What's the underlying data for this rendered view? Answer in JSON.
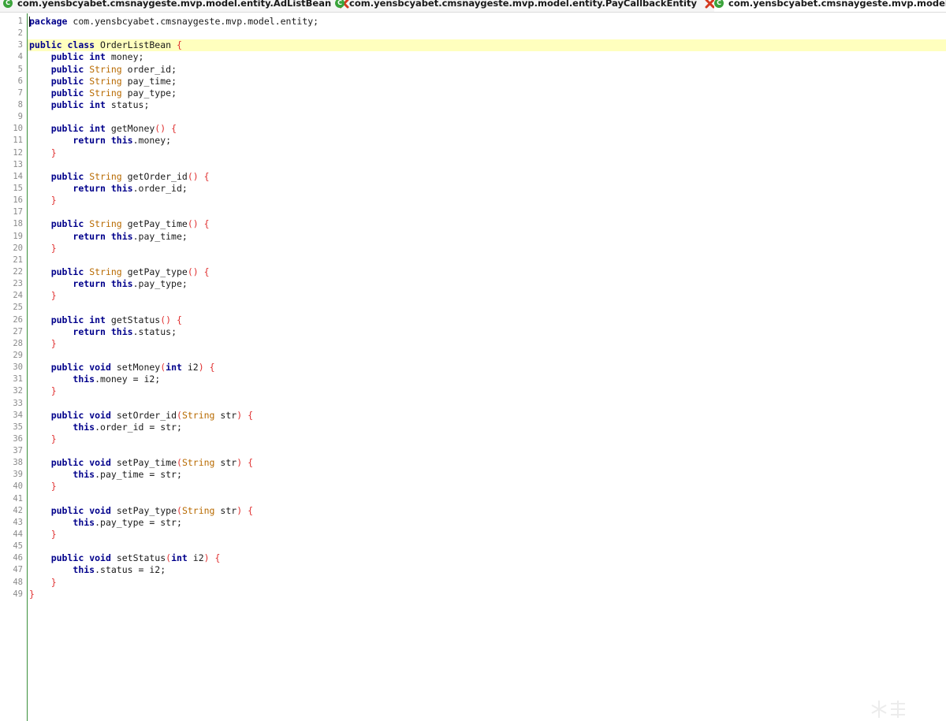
{
  "tabs": [
    {
      "title": "com.yensbcyabet.cmsnaygeste.mvp.model.entity.AdListBean"
    },
    {
      "title": "com.yensbcyabet.cmsnaygeste.mvp.model.entity.PayCallbackEntity"
    },
    {
      "title": "com.yensbcyabet.cmsnaygeste.mvp.model.ent"
    }
  ],
  "tab_icon": "class-icon",
  "close_icon": "close-icon",
  "colors": {
    "keyword": "#00008b",
    "type": "#b86a00",
    "bracket": "#e03030",
    "highlight_line": "#ffffbe",
    "gutter_border": "#3a8f3a",
    "tab_icon": "#3aa33a"
  },
  "editor": {
    "highlighted_line": 3,
    "line_count": 49,
    "code_lines": [
      "package com.yensbcyabet.cmsnaygeste.mvp.model.entity;",
      "",
      "public class OrderListBean {",
      "    public int money;",
      "    public String order_id;",
      "    public String pay_time;",
      "    public String pay_type;",
      "    public int status;",
      "",
      "    public int getMoney() {",
      "        return this.money;",
      "    }",
      "",
      "    public String getOrder_id() {",
      "        return this.order_id;",
      "    }",
      "",
      "    public String getPay_time() {",
      "        return this.pay_time;",
      "    }",
      "",
      "    public String getPay_type() {",
      "        return this.pay_type;",
      "    }",
      "",
      "    public int getStatus() {",
      "        return this.status;",
      "    }",
      "",
      "    public void setMoney(int i2) {",
      "        this.money = i2;",
      "    }",
      "",
      "    public void setOrder_id(String str) {",
      "        this.order_id = str;",
      "    }",
      "",
      "    public void setPay_time(String str) {",
      "        this.pay_time = str;",
      "    }",
      "",
      "    public void setPay_type(String str) {",
      "        this.pay_type = str;",
      "    }",
      "",
      "    public void setStatus(int i2) {",
      "        this.status = i2;",
      "    }",
      "}"
    ]
  }
}
